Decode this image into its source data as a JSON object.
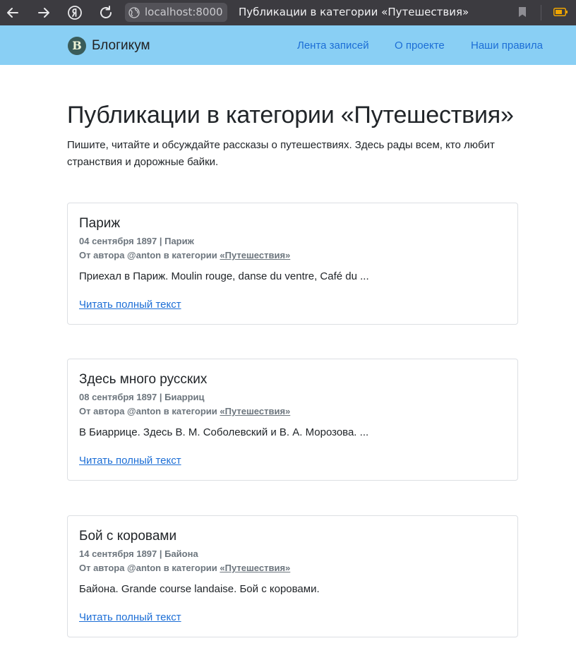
{
  "browser": {
    "url": "localhost:8000",
    "tab_title": "Публикации в категории «Путешествия»"
  },
  "header": {
    "logo_letter": "В",
    "brand": "Блогикум",
    "menu": [
      {
        "label": "Лента записей"
      },
      {
        "label": "О проекте"
      },
      {
        "label": "Наши правила"
      }
    ],
    "background": "#89cff4",
    "link_color": "#1c6ed6"
  },
  "page": {
    "title": "Публикации в категории «Путешествия»",
    "description": "Пишите, читайте и обсуждайте рассказы о путешествиях. Здесь рады всем, кто любит странствия и дорожные байки."
  },
  "posts": [
    {
      "title": "Париж",
      "date_location": "04 сентября 1897 | Париж",
      "author_prefix": "От автора @anton в категории",
      "category": "«Путешествия»",
      "excerpt": "Приехал в Париж. Moulin rouge, danse du ventre, Café du ...",
      "read_more": "Читать полный текст"
    },
    {
      "title": "Здесь много русских",
      "date_location": "08 сентября 1897 | Биарриц",
      "author_prefix": "От автора @anton в категории",
      "category": "«Путешествия»",
      "excerpt": "В Биаррице. Здесь В. М. Соболевский и В. А. Морозова. ...",
      "read_more": "Читать полный текст"
    },
    {
      "title": "Бой с коровами",
      "date_location": "14 сентября 1897 | Байона",
      "author_prefix": "От автора @anton в категории",
      "category": "«Путешествия»",
      "excerpt": "Байона. Grande course landaise. Бой с коровами.",
      "read_more": "Читать полный текст"
    }
  ]
}
